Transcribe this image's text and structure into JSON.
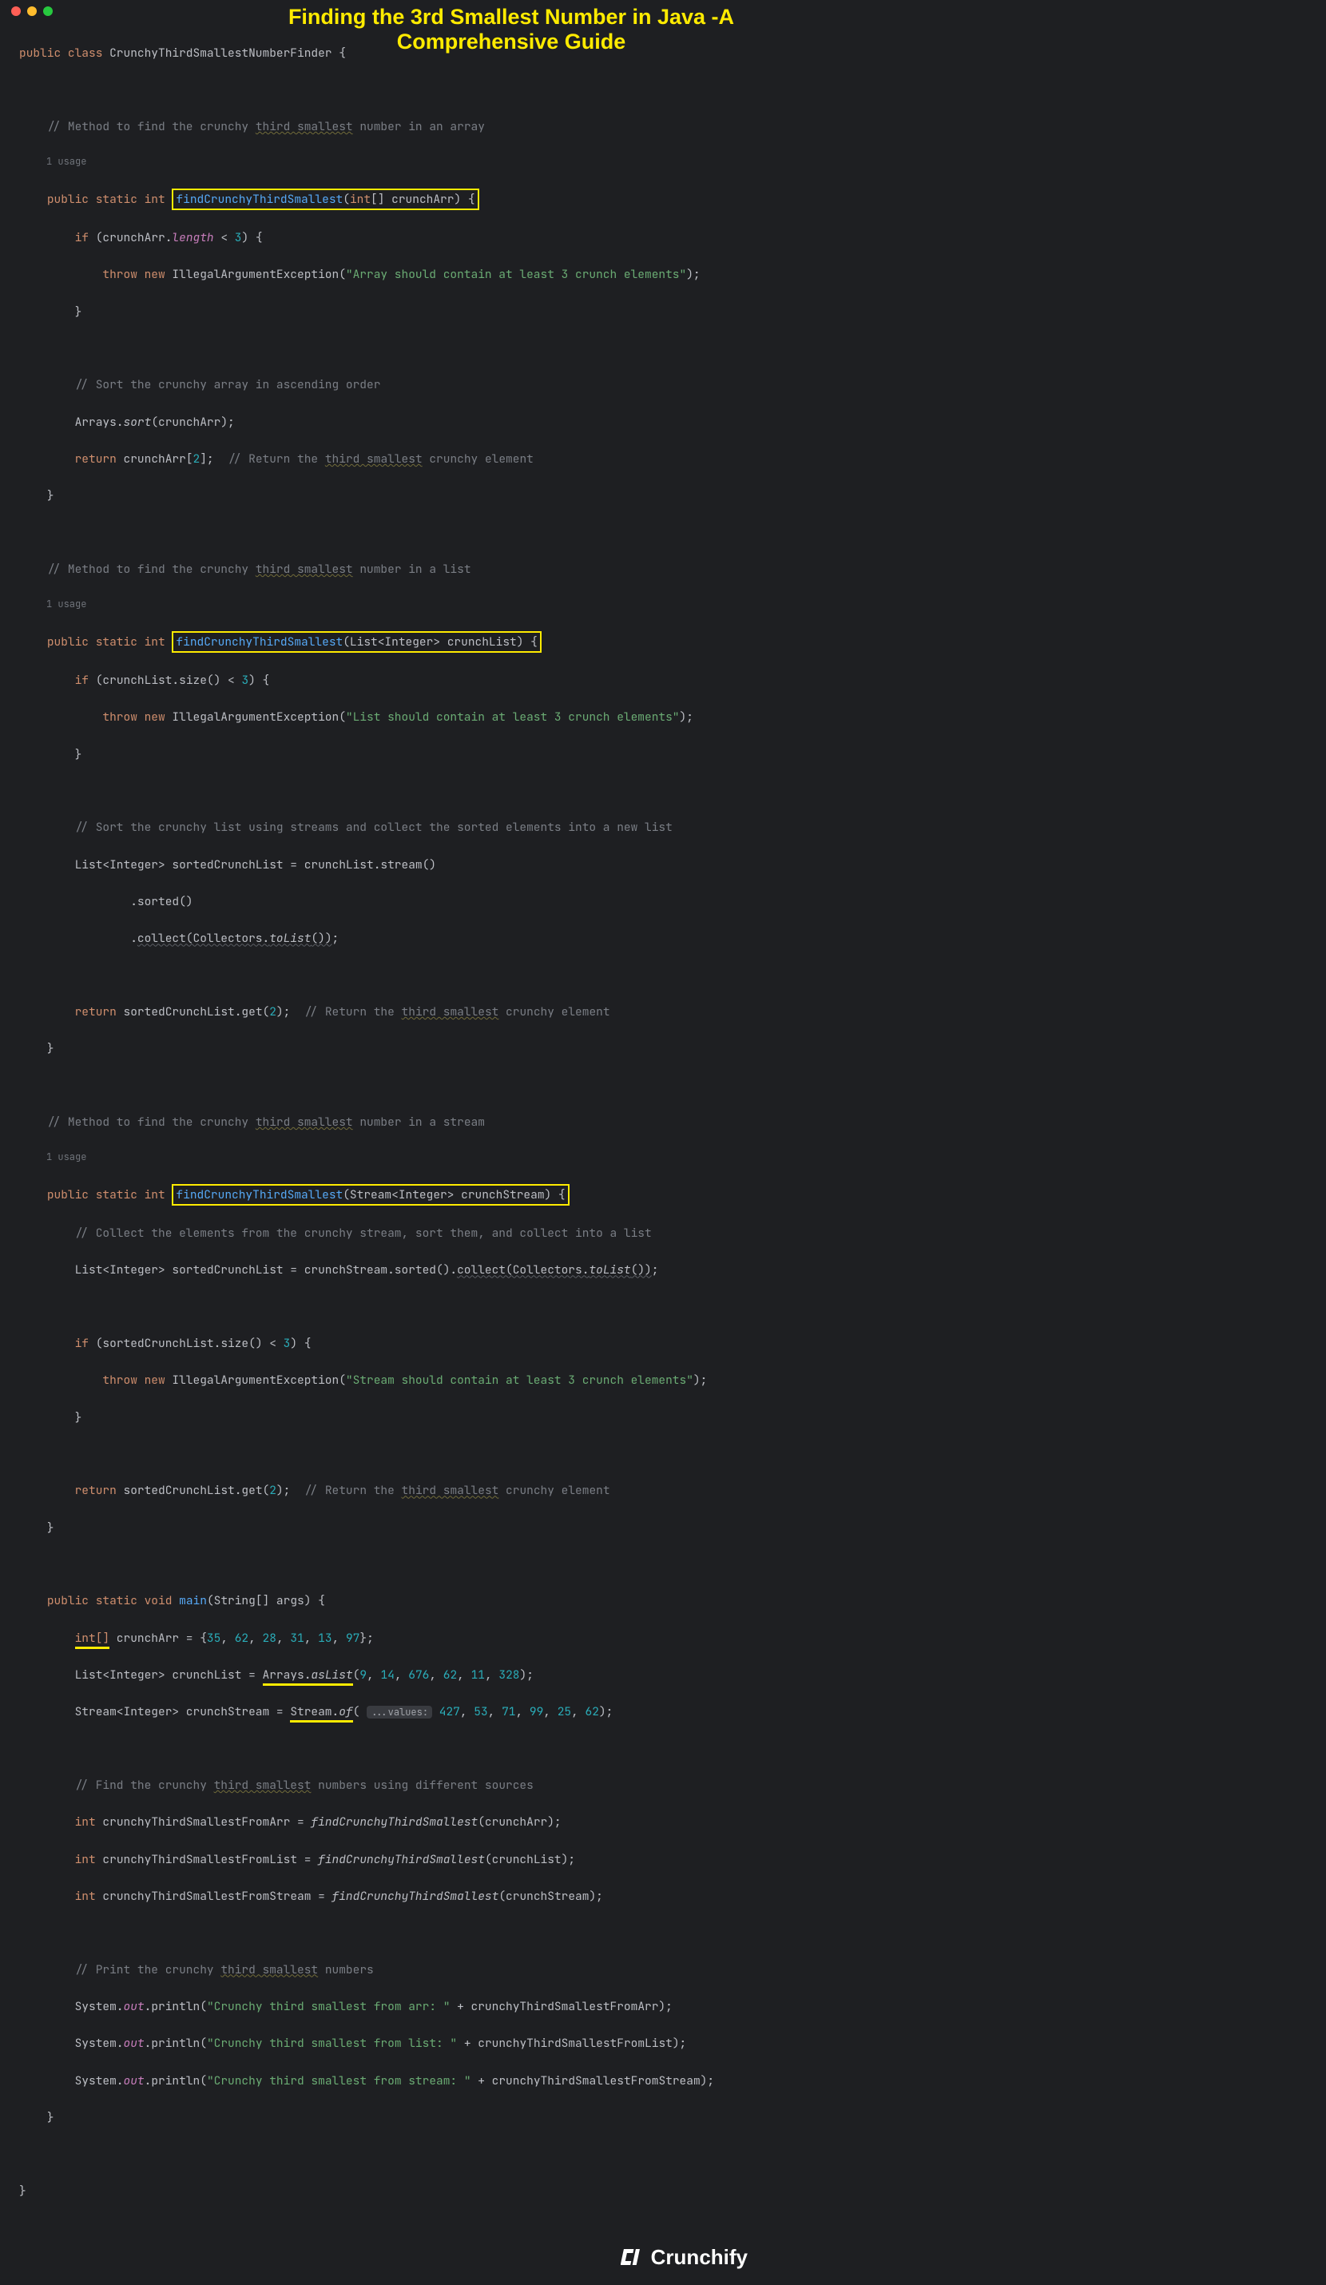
{
  "overlay_title": "Finding the 3rd Smallest Number in Java -A Comprehensive Guide",
  "traffic": {
    "red": "#ff5f56",
    "yellow": "#ffbd2e",
    "green": "#27c93f"
  },
  "class_decl": {
    "kw_public": "public",
    "kw_class": "class",
    "name": "CrunchyThirdSmallestNumberFinder",
    "brace": "{"
  },
  "usage_label": "1 usage",
  "m1": {
    "comment": "// Method to find the crunchy ",
    "comment_wavy": "third smallest",
    "comment_tail": " number in an array",
    "sig_pre": "public static int ",
    "sig_box": "findCrunchyThirdSmallest(int[] crunchArr) {",
    "if_line_a": "if (crunchArr.",
    "if_line_b": "length",
    "if_line_c": " < ",
    "if_line_num": "3",
    "if_line_d": ") {",
    "throw_a": "throw new ",
    "throw_b": "IllegalArgumentException(",
    "throw_str": "\"Array should contain at least 3 crunch elements\"",
    "throw_c": ");",
    "close_brace": "}",
    "sort_cmt": "// Sort the crunchy array in ascending order",
    "sort_line_a": "Arrays.",
    "sort_line_b": "sort",
    "sort_line_c": "(crunchArr);",
    "ret_a": "return ",
    "ret_b": "crunchArr[",
    "ret_num": "2",
    "ret_c": "];  ",
    "ret_cmt_a": "// Return the ",
    "ret_cmt_wavy": "third smallest",
    "ret_cmt_b": " crunchy element"
  },
  "m2": {
    "comment": "// Method to find the crunchy ",
    "comment_wavy": "third smallest",
    "comment_tail": " number in a list",
    "sig_pre": "public static int ",
    "sig_box": "findCrunchyThirdSmallest(List<Integer> crunchList) {",
    "if_a": "if (crunchList.size() < ",
    "if_num": "3",
    "if_b": ") {",
    "throw_a": "throw new ",
    "throw_b": "IllegalArgumentException(",
    "throw_str": "\"List should contain at least 3 crunch elements\"",
    "throw_c": ");",
    "sort_cmt": "// Sort the crunchy list using streams and collect the sorted elements into a new list",
    "l1": "List<Integer> sortedCrunchList = crunchList.stream()",
    "l2": ".sorted()",
    "l3_a": ".",
    "l3_b": "collect(Collectors.",
    "l3_c": "toList",
    "l3_d": "())",
    "l3_e": ";",
    "ret_a": "return ",
    "ret_b": "sortedCrunchList.get(",
    "ret_num": "2",
    "ret_c": ");  ",
    "ret_cmt_a": "// Return the ",
    "ret_cmt_wavy": "third smallest",
    "ret_cmt_b": " crunchy element"
  },
  "m3": {
    "comment": "// Method to find the crunchy ",
    "comment_wavy": "third smallest",
    "comment_tail": " number in a stream",
    "sig_pre": "public static int ",
    "sig_box": "findCrunchyThirdSmallest(Stream<Integer> crunchStream) {",
    "collect_cmt": "// Collect the elements from the crunchy stream, sort them, and collect into a list",
    "l1_a": "List<Integer> sortedCrunchList = crunchStream.sorted().",
    "l1_b": "collect(Collectors.",
    "l1_c": "toList",
    "l1_d": "())",
    "l1_e": ";",
    "if_a": "if (sortedCrunchList.size() < ",
    "if_num": "3",
    "if_b": ") {",
    "throw_a": "throw new ",
    "throw_b": "IllegalArgumentException(",
    "throw_str": "\"Stream should contain at least 3 crunch elements\"",
    "throw_c": ");",
    "ret_a": "return ",
    "ret_b": "sortedCrunchList.get(",
    "ret_num": "2",
    "ret_c": ");  ",
    "ret_cmt_a": "// Return the ",
    "ret_cmt_wavy": "third smallest",
    "ret_cmt_b": " crunchy element"
  },
  "main": {
    "sig": "public static void ",
    "sig_name": "main",
    "sig_tail": "(String[] args) {",
    "arr_a": "int[]",
    "arr_b": " crunchArr = {",
    "arr_vals": [
      "35",
      "62",
      "28",
      "31",
      "13",
      "97"
    ],
    "arr_c": "};",
    "list_a": "List<Integer> crunchList = ",
    "list_b": "Arrays",
    "list_c": ".",
    "list_d": "asList",
    "list_e": "(",
    "list_vals": [
      "9",
      "14",
      "676",
      "62",
      "11",
      "328"
    ],
    "list_f": ");",
    "stream_a": "Stream<Integer> crunchStream = ",
    "stream_b": "Stream",
    "stream_c": ".",
    "stream_d": "of",
    "stream_e": "(",
    "hint": "...values:",
    "stream_vals": [
      "427",
      "53",
      "71",
      "99",
      "25",
      "62"
    ],
    "stream_f": ");",
    "find_cmt_a": "// Find the crunchy ",
    "find_cmt_wavy": "third smallest",
    "find_cmt_b": " numbers using different sources",
    "c1_a": "int ",
    "c1_b": "crunchyThirdSmallestFromArr = ",
    "c1_c": "findCrunchyThirdSmallest",
    "c1_d": "(crunchArr);",
    "c2_a": "int ",
    "c2_b": "crunchyThirdSmallestFromList = ",
    "c2_c": "findCrunchyThirdSmallest",
    "c2_d": "(crunchList);",
    "c3_a": "int ",
    "c3_b": "crunchyThirdSmallestFromStream = ",
    "c3_c": "findCrunchyThirdSmallest",
    "c3_d": "(crunchStream);",
    "print_cmt_a": "// Print the crunchy ",
    "print_cmt_wavy": "third smallest",
    "print_cmt_b": " numbers",
    "p1_a": "System.",
    "p1_b": "out",
    "p1_c": ".println(",
    "p1_str": "\"Crunchy third smallest from arr: \"",
    "p1_d": " + crunchyThirdSmallestFromArr);",
    "p2_str": "\"Crunchy third smallest from list: \"",
    "p2_d": " + crunchyThirdSmallestFromList);",
    "p3_str": "\"Crunchy third smallest from stream: \"",
    "p3_d": " + crunchyThirdSmallestFromStream);"
  },
  "logo_text": "Crunchify"
}
